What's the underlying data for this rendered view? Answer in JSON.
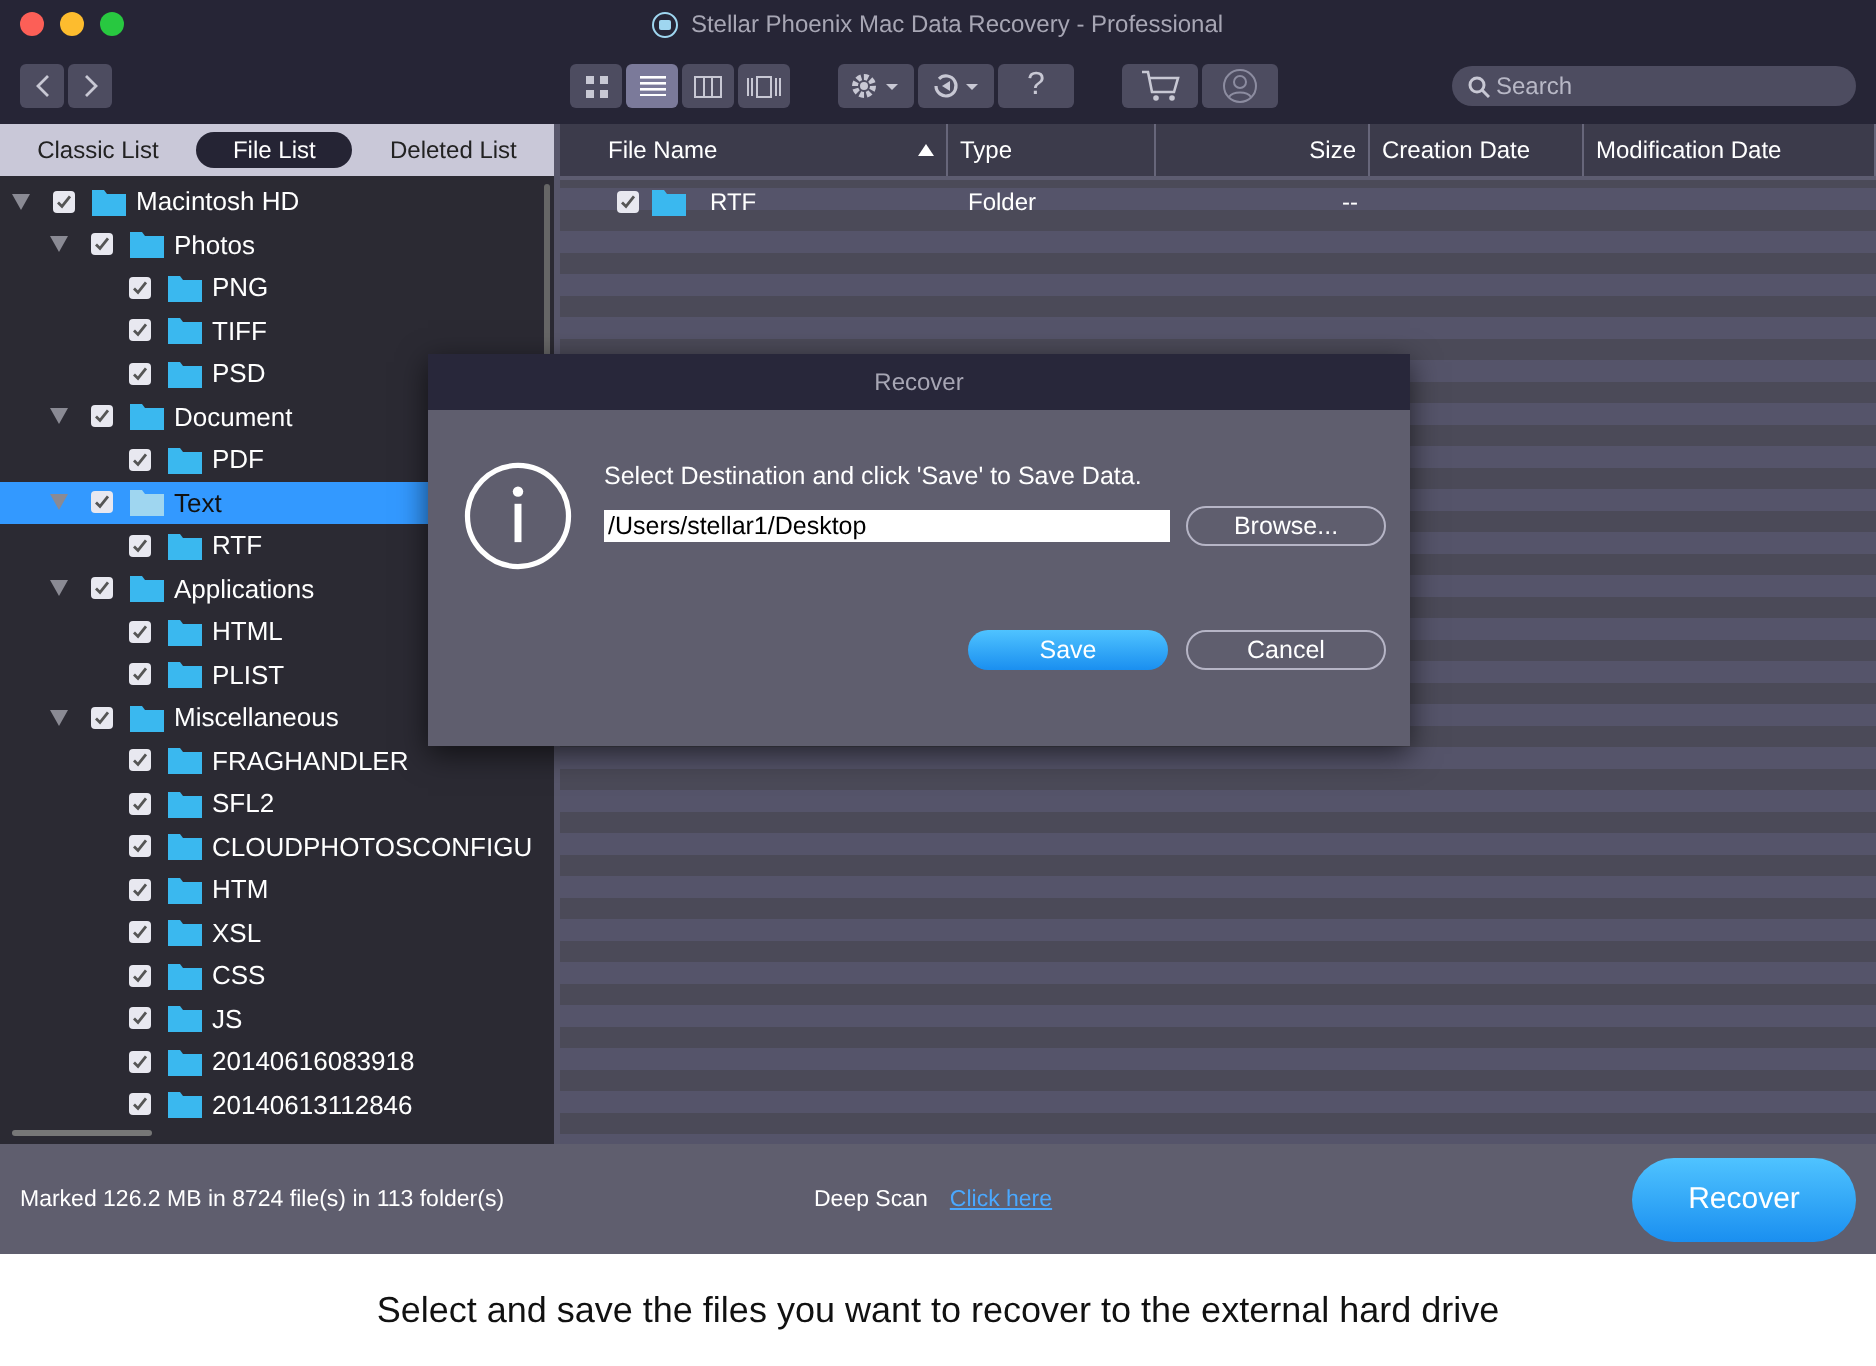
{
  "window": {
    "title": "Stellar Phoenix Mac Data Recovery - Professional"
  },
  "toolbar": {
    "views": [
      {
        "kind": "grid",
        "selected": false
      },
      {
        "kind": "list",
        "selected": true
      },
      {
        "kind": "columns",
        "selected": false
      },
      {
        "kind": "coverflow",
        "selected": false
      }
    ],
    "help": "?",
    "search": {
      "placeholder": "Search"
    }
  },
  "list_tabs": [
    {
      "label": "Classic List",
      "selected": false
    },
    {
      "label": "File List",
      "selected": true
    },
    {
      "label": "Deleted List",
      "selected": false
    }
  ],
  "tree": [
    {
      "label": "Macintosh HD",
      "checked": true,
      "expanded": true,
      "selected": false,
      "children": [
        {
          "label": "Photos",
          "checked": true,
          "expanded": true,
          "selected": false,
          "children": [
            {
              "label": "PNG",
              "checked": true,
              "selected": false
            },
            {
              "label": "TIFF",
              "checked": true,
              "selected": false
            },
            {
              "label": "PSD",
              "checked": true,
              "selected": false
            }
          ]
        },
        {
          "label": "Document",
          "checked": true,
          "expanded": true,
          "selected": false,
          "children": [
            {
              "label": "PDF",
              "checked": true,
              "selected": false
            }
          ]
        },
        {
          "label": "Text",
          "checked": true,
          "expanded": true,
          "selected": true,
          "children": [
            {
              "label": "RTF",
              "checked": true,
              "selected": false
            }
          ]
        },
        {
          "label": "Applications",
          "checked": true,
          "expanded": true,
          "selected": false,
          "children": [
            {
              "label": "HTML",
              "checked": true,
              "selected": false
            },
            {
              "label": "PLIST",
              "checked": true,
              "selected": false
            }
          ]
        },
        {
          "label": "Miscellaneous",
          "checked": true,
          "expanded": true,
          "selected": false,
          "children": [
            {
              "label": "FRAGHANDLER",
              "checked": true,
              "selected": false
            },
            {
              "label": "SFL2",
              "checked": true,
              "selected": false
            },
            {
              "label": "CLOUDPHOTOSCONFIGU",
              "checked": true,
              "selected": false
            },
            {
              "label": "HTM",
              "checked": true,
              "selected": false
            },
            {
              "label": "XSL",
              "checked": true,
              "selected": false
            },
            {
              "label": "CSS",
              "checked": true,
              "selected": false
            },
            {
              "label": "JS",
              "checked": true,
              "selected": false
            },
            {
              "label": "20140616083918",
              "checked": true,
              "selected": false
            },
            {
              "label": "20140613112846",
              "checked": true,
              "selected": false
            }
          ]
        }
      ]
    }
  ],
  "table": {
    "columns": [
      {
        "label": "File Name",
        "sorted": true
      },
      {
        "label": "Type",
        "sorted": false
      },
      {
        "label": "Size",
        "sorted": false
      },
      {
        "label": "Creation Date",
        "sorted": false
      },
      {
        "label": "Modification Date",
        "sorted": false
      }
    ],
    "rows": [
      {
        "checked": true,
        "name": "RTF",
        "type": "Folder",
        "size": "--"
      }
    ]
  },
  "dialog": {
    "title": "Recover",
    "message": "Select Destination and click 'Save' to Save Data.",
    "path": "/Users/stellar1/Desktop",
    "browse": "Browse...",
    "save": "Save",
    "cancel": "Cancel"
  },
  "status_bar": {
    "summary": "Marked 126.2 MB in 8724 file(s) in 113 folder(s)",
    "deep_scan": "Deep Scan",
    "link": "Click here",
    "recover": "Recover"
  },
  "caption": "Select and save the files you want to recover to the external hard drive"
}
